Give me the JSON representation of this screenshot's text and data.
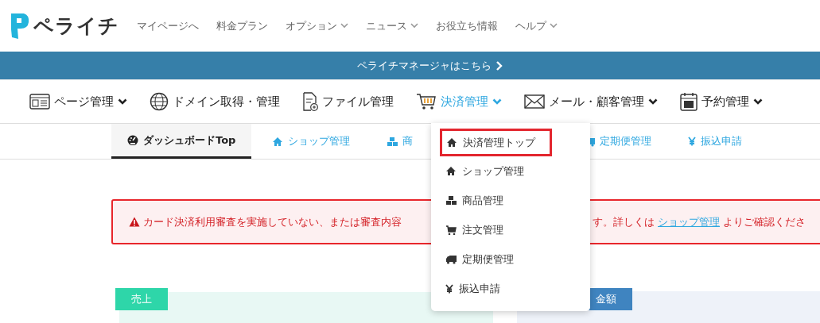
{
  "header": {
    "logo": "ペライチ",
    "links": [
      {
        "label": "マイページへ",
        "dropdown": false
      },
      {
        "label": "料金プラン",
        "dropdown": false
      },
      {
        "label": "オプション",
        "dropdown": true
      },
      {
        "label": "ニュース",
        "dropdown": true
      },
      {
        "label": "お役立ち情報",
        "dropdown": false
      },
      {
        "label": "ヘルプ",
        "dropdown": true
      }
    ]
  },
  "banner": {
    "label": "ペライチマネージャはこちら"
  },
  "main_nav": [
    {
      "label": "ページ管理",
      "dropdown": true,
      "selected": false
    },
    {
      "label": "ドメイン取得・管理",
      "dropdown": false,
      "selected": false
    },
    {
      "label": "ファイル管理",
      "dropdown": false,
      "selected": false
    },
    {
      "label": "決済管理",
      "dropdown": true,
      "selected": true
    },
    {
      "label": "メール・顧客管理",
      "dropdown": true,
      "selected": false
    },
    {
      "label": "予約管理",
      "dropdown": true,
      "selected": false
    }
  ],
  "sub_nav": [
    {
      "label": "ダッシュボードTop",
      "selected": true
    },
    {
      "label": "ショップ管理",
      "selected": false
    },
    {
      "label": "商",
      "selected": false
    },
    {
      "label": "定期便管理",
      "selected": false
    },
    {
      "label": "振込申請",
      "selected": false
    }
  ],
  "dropdown_menu": [
    {
      "label": "決済管理トップ",
      "selected": true
    },
    {
      "label": "ショップ管理",
      "selected": false
    },
    {
      "label": "商品管理",
      "selected": false
    },
    {
      "label": "注文管理",
      "selected": false
    },
    {
      "label": "定期便管理",
      "selected": false
    },
    {
      "label": "振込申請",
      "selected": false
    }
  ],
  "alert": {
    "text_start": "カード決済利用審査を実施していない、または審査内容",
    "text_middle": "す。詳しくは",
    "link": "ショップ管理",
    "text_end": "よりご確認くださ"
  },
  "cards": [
    {
      "label": "売上",
      "color": "#2ed6a9"
    },
    {
      "label": "金額",
      "color": "#3f84c0"
    }
  ]
}
